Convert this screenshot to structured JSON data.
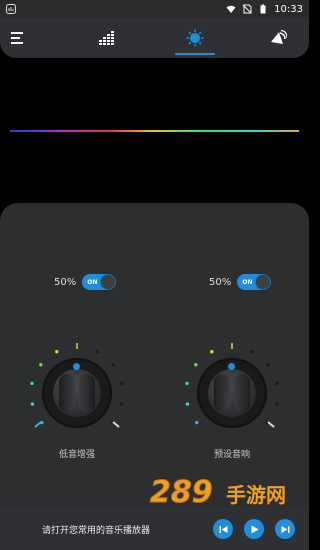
{
  "status_bar": {
    "time": "10:33",
    "icons": [
      "notification-icon",
      "wifi-icon",
      "no-sim-icon",
      "battery-icon"
    ]
  },
  "toolbar": {
    "tabs": [
      {
        "name": "menu",
        "icon": "menu-icon",
        "active": false
      },
      {
        "name": "equalizer",
        "icon": "equalizer-icon",
        "active": false
      },
      {
        "name": "bass-boost",
        "icon": "sun-gear-icon",
        "active": true
      },
      {
        "name": "virtualizer",
        "icon": "speaker-icon",
        "active": false
      }
    ]
  },
  "visualizer": {
    "colors": [
      "#2b3bd8",
      "#b02bd8",
      "#e62b4b",
      "#e6c32b",
      "#2be66a",
      "#2bd8d8",
      "#e6a42b"
    ]
  },
  "effects": {
    "bass": {
      "percent": "50%",
      "toggle_label": "ON",
      "label": "低音增强",
      "level": 0.5,
      "on": true
    },
    "virtualizer": {
      "percent": "50%",
      "toggle_label": "ON",
      "label": "预设音响",
      "level": 0.5,
      "on": true
    }
  },
  "player": {
    "prompt": "请打开您常用的音乐播放器",
    "controls": [
      "previous-icon",
      "play-icon",
      "next-icon"
    ]
  },
  "watermark": {
    "text": "手游网",
    "digits": "289"
  },
  "colors": {
    "accent": "#1e8fe0",
    "panel": "#2d2e30",
    "toolbar": "#2f3033"
  }
}
